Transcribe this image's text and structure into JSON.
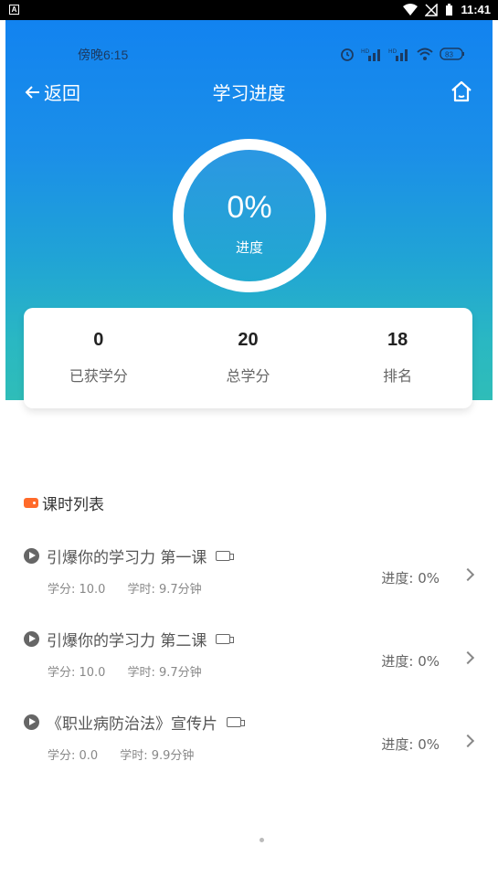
{
  "system_bar": {
    "time": "11:41"
  },
  "inner_status": {
    "time": "傍晚6:15",
    "battery": "83"
  },
  "nav": {
    "back_label": "返回",
    "title": "学习进度"
  },
  "progress": {
    "percent_text": "0%",
    "label": "进度"
  },
  "stats": [
    {
      "value": "0",
      "caption": "已获学分"
    },
    {
      "value": "20",
      "caption": "总学分"
    },
    {
      "value": "18",
      "caption": "排名"
    }
  ],
  "section": {
    "title": "课时列表"
  },
  "lessons": [
    {
      "title": "引爆你的学习力 第一课",
      "credit": "学分: 10.0",
      "hours": "学时: 9.7分钟",
      "progress": "进度: 0%"
    },
    {
      "title": "引爆你的学习力 第二课",
      "credit": "学分: 10.0",
      "hours": "学时: 9.7分钟",
      "progress": "进度: 0%"
    },
    {
      "title": "《职业病防治法》宣传片",
      "credit": "学分: 0.0",
      "hours": "学时: 9.9分钟",
      "progress": "进度: 0%"
    }
  ],
  "colors": {
    "primary": "#1283f0",
    "accent": "#ff6a2a",
    "teal": "#2fbdb8"
  }
}
